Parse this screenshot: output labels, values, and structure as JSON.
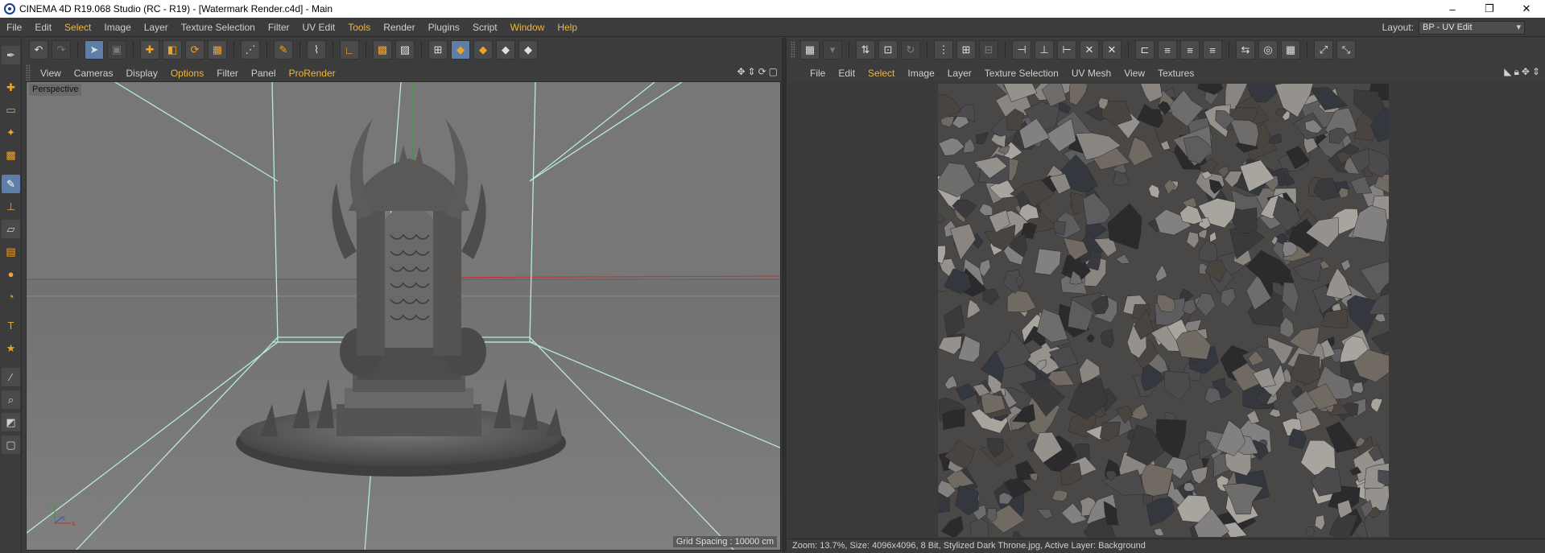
{
  "window": {
    "title": "CINEMA 4D R19.068 Studio (RC - R19) - [Watermark Render.c4d] - Main",
    "controls": [
      "–",
      "❐",
      "✕"
    ]
  },
  "menubar": {
    "items": [
      {
        "label": "File",
        "highlight": false
      },
      {
        "label": "Edit",
        "highlight": false
      },
      {
        "label": "Select",
        "highlight": true
      },
      {
        "label": "Image",
        "highlight": false
      },
      {
        "label": "Layer",
        "highlight": false
      },
      {
        "label": "Texture Selection",
        "highlight": false
      },
      {
        "label": "Filter",
        "highlight": false
      },
      {
        "label": "UV Edit",
        "highlight": false
      },
      {
        "label": "Tools",
        "highlight": true
      },
      {
        "label": "Render",
        "highlight": false
      },
      {
        "label": "Plugins",
        "highlight": false
      },
      {
        "label": "Script",
        "highlight": false
      },
      {
        "label": "Window",
        "highlight": true
      },
      {
        "label": "Help",
        "highlight": true
      }
    ],
    "layout_label": "Layout:",
    "layout_value": "BP - UV Edit"
  },
  "viewport": {
    "menu": [
      {
        "label": "View",
        "highlight": false
      },
      {
        "label": "Cameras",
        "highlight": false
      },
      {
        "label": "Display",
        "highlight": false
      },
      {
        "label": "Options",
        "highlight": true
      },
      {
        "label": "Filter",
        "highlight": false
      },
      {
        "label": "Panel",
        "highlight": false
      },
      {
        "label": "ProRender",
        "highlight": true
      }
    ],
    "label": "Perspective",
    "grid_spacing": "Grid Spacing : 10000 cm",
    "axis_x": "x",
    "axis_y": "y",
    "axis_z": "z"
  },
  "uv_editor": {
    "menu": [
      {
        "label": "File",
        "highlight": false
      },
      {
        "label": "Edit",
        "highlight": false
      },
      {
        "label": "Select",
        "highlight": true
      },
      {
        "label": "Image",
        "highlight": false
      },
      {
        "label": "Layer",
        "highlight": false
      },
      {
        "label": "Texture Selection",
        "highlight": false
      },
      {
        "label": "UV Mesh",
        "highlight": false
      },
      {
        "label": "View",
        "highlight": false
      },
      {
        "label": "Textures",
        "highlight": false
      }
    ],
    "status": "Zoom: 13.7%, Size: 4096x4096, 8 Bit, Stylized Dark Throne.jpg, Active Layer: Background"
  },
  "colors": {
    "accent": "#f0b73c",
    "viewport_bg": "#7a7a7a",
    "panel_bg": "#3c3c3c"
  }
}
